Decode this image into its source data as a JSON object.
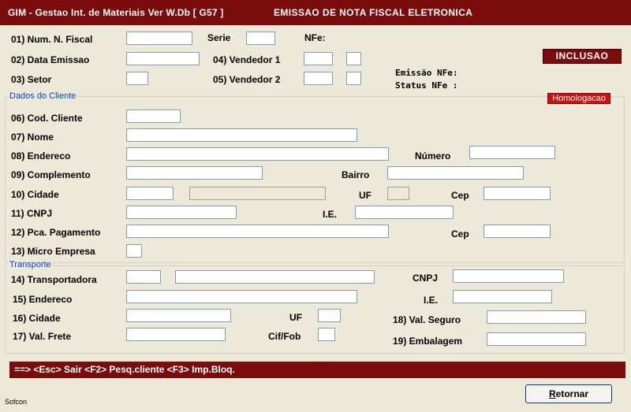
{
  "window": {
    "title": "GIM - Gestao Int. de Materiais  Ver W.Db  [ G57 ]",
    "subtitle": "EMISSAO DE NOTA FISCAL ELETRONICA"
  },
  "header": {
    "num_nf_label": "01)  Num. N. Fiscal",
    "serie_label": "Serie",
    "nfe_label": "NFe:",
    "data_emissao_label": "02)  Data Emissao",
    "vendedor1_label": "04)  Vendedor 1",
    "setor_label": "03)  Setor",
    "vendedor2_label": "05)  Vendedor 2",
    "emissao_nfe_label": "Emissão NFe:",
    "status_nfe_label": "Status NFe :",
    "mode_badge": "INCLUSAO",
    "env_badge": "Homologacao"
  },
  "cliente": {
    "legend": "Dados do Cliente",
    "cod_cliente_label": "06)  Cod. Cliente",
    "nome_label": "07)  Nome",
    "endereco_label": "08)  Endereco",
    "numero_label": "Número",
    "complemento_label": "09)  Complemento",
    "bairro_label": "Bairro",
    "cidade_label": "10)  Cidade",
    "uf_label": "UF",
    "cep_label": "Cep",
    "cnpj_label": "11)  CNPJ",
    "ie_label": "I.E.",
    "pca_pagamento_label": "12)  Pca. Pagamento",
    "cep2_label": "Cep",
    "micro_empresa_label": "13)  Micro Empresa"
  },
  "transporte": {
    "legend": "Transporte",
    "transportadora_label": "14)  Transportadora",
    "cnpj_label": "CNPJ",
    "endereco_label": "15)  Endereco",
    "ie_label": "I.E.",
    "cidade_label": "16)  Cidade",
    "uf_label": "UF",
    "val_seguro_label": "18)  Val. Seguro",
    "val_frete_label": "17)  Val. Frete",
    "cif_fob_label": "Cif/Fob",
    "embalagem_label": "19)  Embalagem"
  },
  "status_bar": "==>  <Esc> Sair  <F2> Pesq.cliente  <F3> Imp.Bloq.",
  "buttons": {
    "retornar_first": "R",
    "retornar_rest": "etornar"
  },
  "footer": "Sofcon",
  "colors": {
    "titlebar": "#7A0C0C",
    "badge": "#7A0C0C",
    "homologacao": "#D01010",
    "legend": "#0044CC"
  }
}
